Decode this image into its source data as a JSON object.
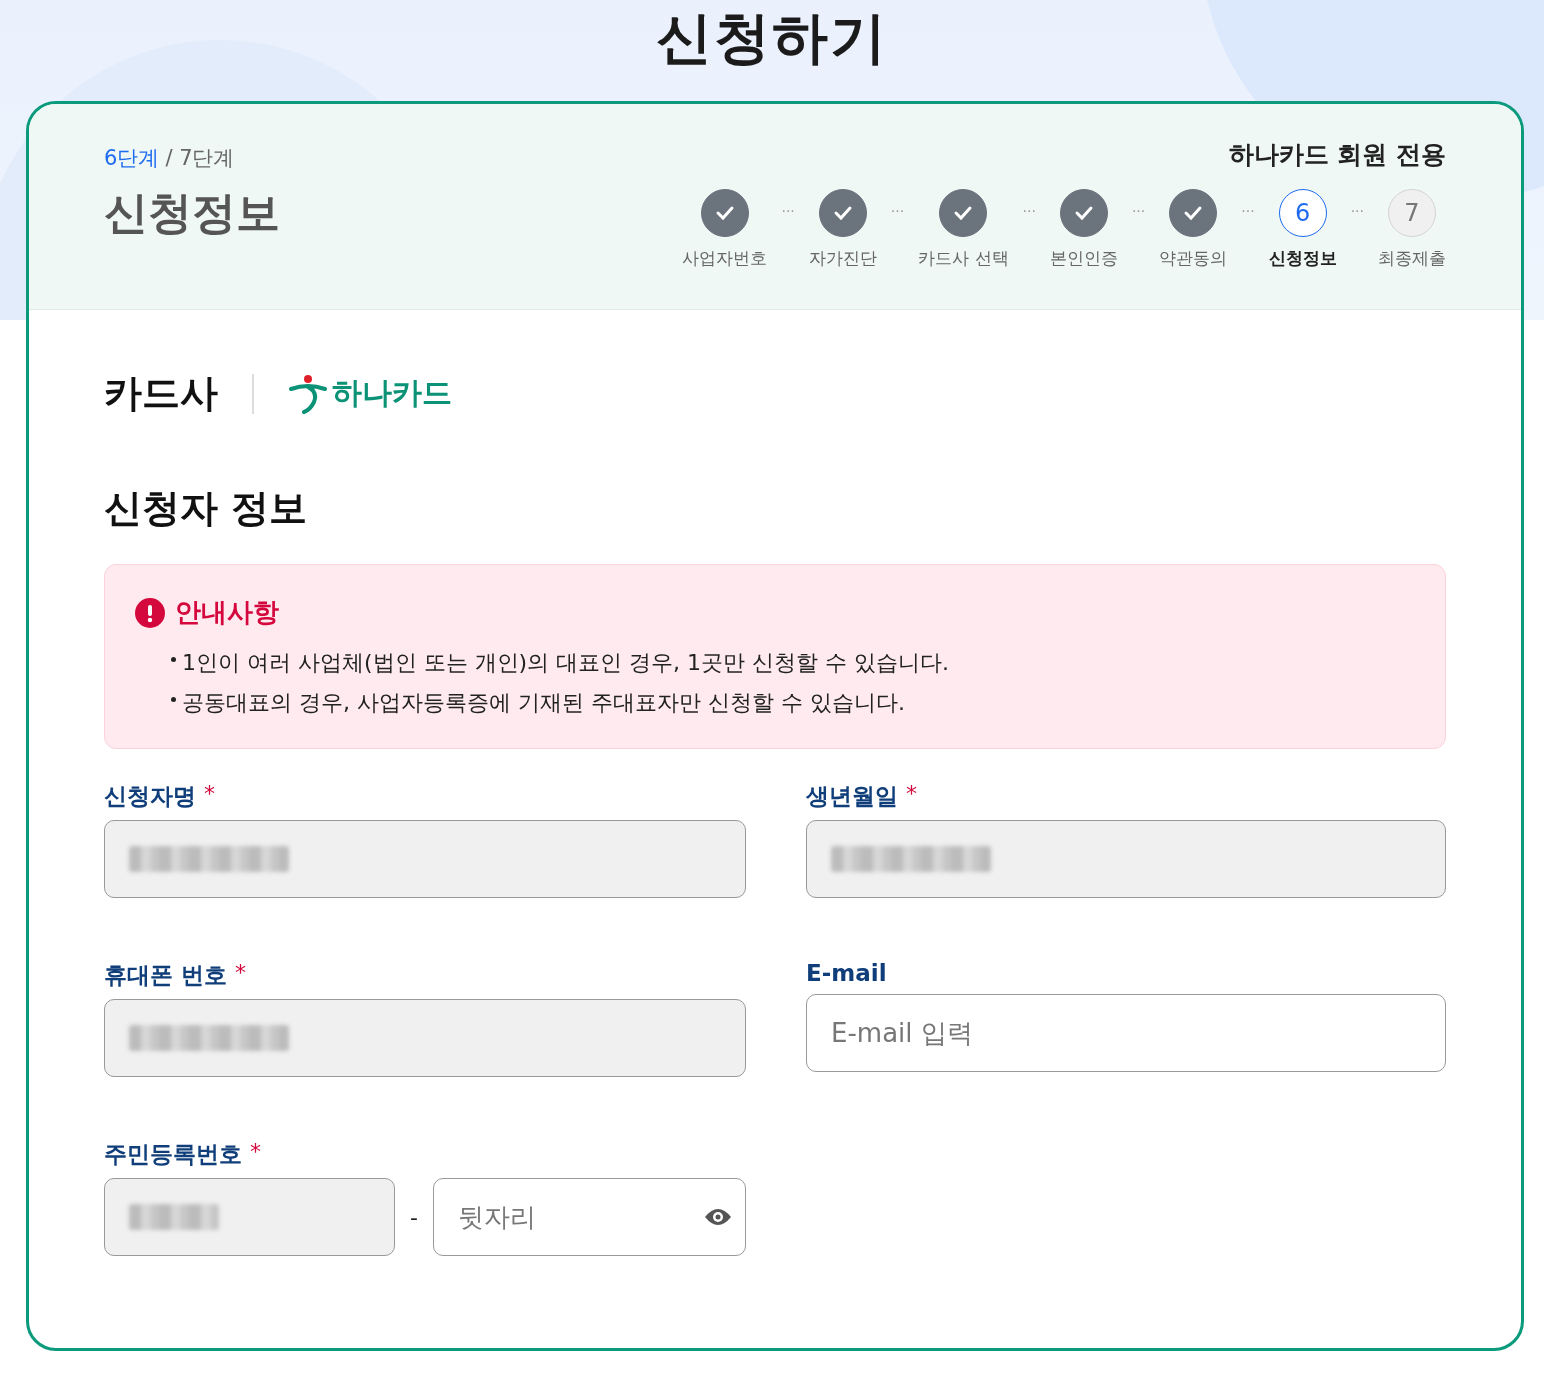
{
  "page_title": "신청하기",
  "header": {
    "current_step": "6단계",
    "total_steps": "/ 7단계",
    "section_title": "신청정보",
    "badge": "하나카드 회원 전용",
    "steps": [
      {
        "label": "사업자번호",
        "kind": "done"
      },
      {
        "label": "자가진단",
        "kind": "done"
      },
      {
        "label": "카드사 선택",
        "kind": "done"
      },
      {
        "label": "본인인증",
        "kind": "done"
      },
      {
        "label": "약관동의",
        "kind": "done"
      },
      {
        "label": "신청정보",
        "kind": "current",
        "number": "6"
      },
      {
        "label": "최종제출",
        "kind": "pending",
        "number": "7"
      }
    ],
    "separator": "···"
  },
  "card_company": {
    "label": "카드사",
    "brand": "하나카드"
  },
  "applicant": {
    "title": "신청자 정보",
    "notice": {
      "title": "안내사항",
      "items": [
        "1인이 여러 사업체(법인 또는 개인)의 대표인 경우, 1곳만 신청할 수 있습니다.",
        "공동대표의 경우, 사업자등록증에 기재된 주대표자만 신청할 수 있습니다."
      ]
    },
    "fields": [
      {
        "label": "신청자명",
        "required_mark": "*",
        "kind": "redacted"
      },
      {
        "label": "생년월일",
        "required_mark": "*",
        "kind": "redacted"
      },
      {
        "label": "휴대폰 번호",
        "required_mark": "*",
        "kind": "redacted"
      },
      {
        "label": "E-mail",
        "kind": "input",
        "placeholder": "E-mail 입력"
      }
    ],
    "resident_number": {
      "label": "주민등록번호",
      "required_mark": "*",
      "front": {
        "kind": "redacted"
      },
      "dash": "-",
      "back": {
        "kind": "input",
        "placeholder": "뒷자리"
      }
    }
  }
}
